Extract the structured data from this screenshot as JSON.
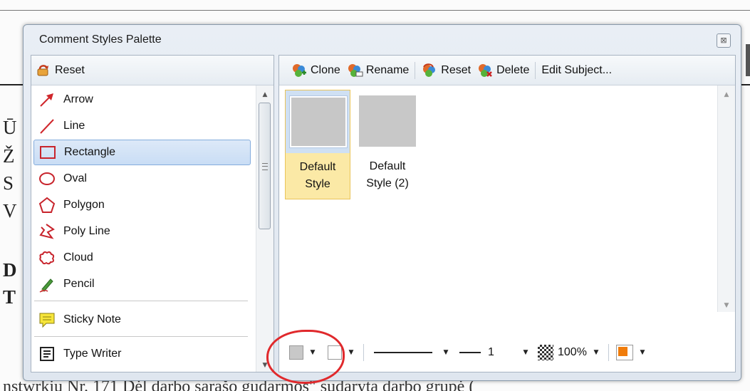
{
  "window": {
    "title": "Comment Styles Palette",
    "close_glyph": "⊠"
  },
  "left_toolbar": {
    "reset_label": "Reset",
    "reset_icon": "reset-icon"
  },
  "tools": [
    {
      "label": "Arrow",
      "icon": "arrow-icon"
    },
    {
      "label": "Line",
      "icon": "line-icon"
    },
    {
      "label": "Rectangle",
      "icon": "rectangle-icon",
      "selected": true
    },
    {
      "label": "Oval",
      "icon": "oval-icon"
    },
    {
      "label": "Polygon",
      "icon": "polygon-icon"
    },
    {
      "label": "Poly Line",
      "icon": "polyline-icon"
    },
    {
      "label": "Cloud",
      "icon": "cloud-icon"
    },
    {
      "label": "Pencil",
      "icon": "pencil-icon"
    },
    {
      "label": "Sticky Note",
      "icon": "sticky-note-icon"
    },
    {
      "label": "Type Writer",
      "icon": "typewriter-icon"
    }
  ],
  "right_toolbar": {
    "clone_label": "Clone",
    "rename_label": "Rename",
    "reset_label": "Reset",
    "delete_label": "Delete",
    "edit_subject_label": "Edit Subject..."
  },
  "styles": [
    {
      "label_line1": "Default",
      "label_line2": "Style",
      "selected": true
    },
    {
      "label_line1": "Default",
      "label_line2": "Style (2)",
      "selected": false
    }
  ],
  "properties": {
    "line_width": "1",
    "opacity": "100%",
    "fill_color": "#c8c8c8",
    "border_color": "#ffffff"
  },
  "background": {
    "letters": [
      "Ū",
      "Ž",
      "S",
      "V",
      "D",
      "T"
    ],
    "bottom_text": "nstwrkiu Nr. 171   Dėl darbo sąrašo gudarmos\" sudaryta darbo grupė ("
  },
  "colors": {
    "accent_red": "#e0292c",
    "selection_blue": "#c9ddf5",
    "selection_yellow": "#fbe9a6"
  }
}
